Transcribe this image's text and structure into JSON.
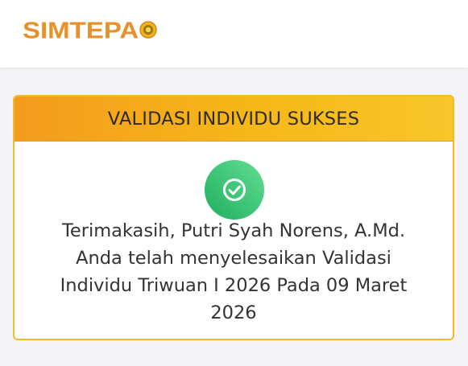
{
  "header": {
    "logo_text": "SIMTEPA",
    "logo_icon": "circle-emblem-icon"
  },
  "card": {
    "title": "VALIDASI INDIVIDU SUKSES",
    "icon": "check-circle-icon",
    "message_lines": [
      "Terimakasih, Putri Syah Norens, A.Md.",
      "Anda telah menyelesaikan Validasi",
      "Individu Triwuan I 2026 Pada 09 Maret",
      "2026"
    ]
  },
  "colors": {
    "brand": "#e8902a",
    "header_gradient_start": "#f49b1e",
    "header_gradient_end": "#f7c62a",
    "success_start": "#21b968",
    "success_end": "#55d98a"
  }
}
